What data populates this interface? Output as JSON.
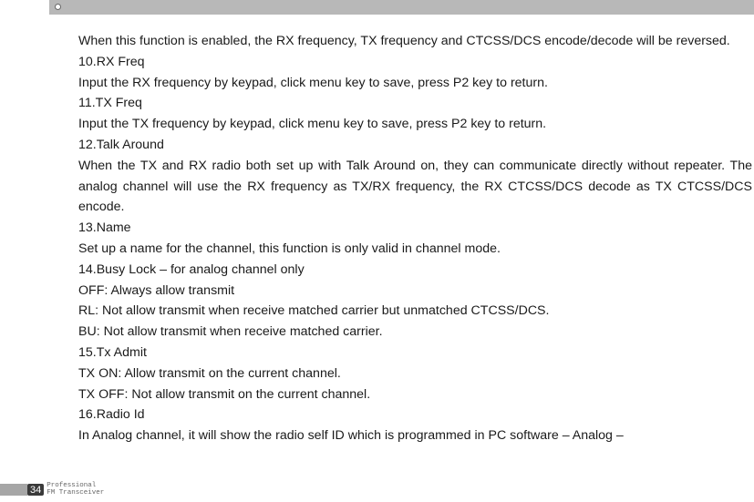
{
  "content": {
    "lines": [
      "When this function is enabled, the RX frequency, TX frequency and CTCSS/DCS encode/decode will be reversed.",
      "10.RX Freq",
      "Input the RX frequency by keypad, click menu key to save, press P2 key to return.",
      "11.TX Freq",
      "Input the TX frequency by keypad, click menu key to save, press P2 key to return.",
      "12.Talk Around",
      "When the TX and RX radio both set up with Talk Around on, they can communicate directly without repeater. The analog channel will use the RX frequency as TX/RX frequency, the RX CTCSS/DCS decode as TX CTCSS/DCS encode.",
      "13.Name",
      "Set up a name for the channel, this function is only valid in channel mode.",
      "14.Busy Lock – for analog channel only",
      "OFF: Always allow transmit",
      "RL: Not allow transmit when receive matched carrier but unmatched CTCSS/DCS.",
      "BU: Not allow transmit when receive matched carrier.",
      "15.Tx Admit",
      "TX ON: Allow transmit on the current channel.",
      "TX OFF: Not allow transmit on the current channel.",
      "16.Radio Id",
      "In Analog channel, it will show the radio self ID which is programmed in PC software – Analog –"
    ]
  },
  "footer": {
    "page_number": "34",
    "line1": "Professional",
    "line2": "FM Transceiver"
  }
}
